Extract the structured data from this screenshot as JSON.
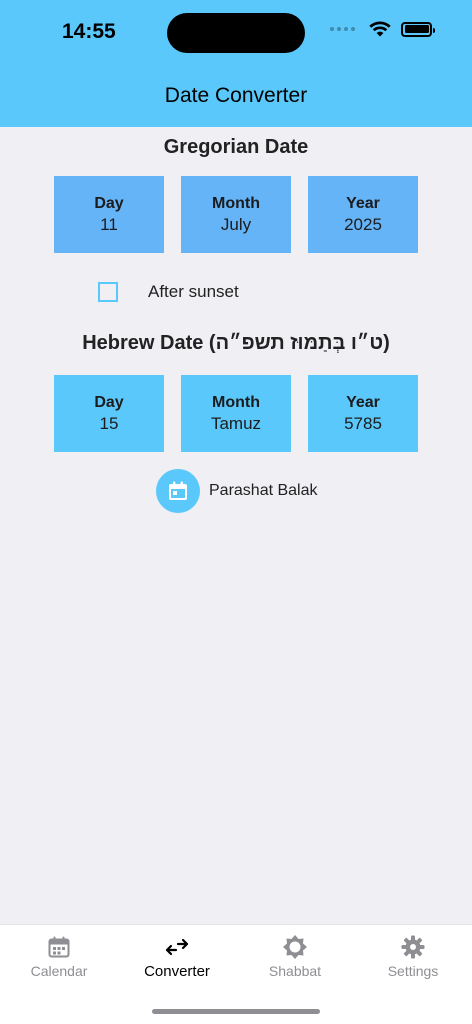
{
  "status_bar": {
    "time": "14:55"
  },
  "nav": {
    "title": "Date Converter"
  },
  "gregorian": {
    "title": "Gregorian Date",
    "day": {
      "label": "Day",
      "value": "11"
    },
    "month": {
      "label": "Month",
      "value": "July"
    },
    "year": {
      "label": "Year",
      "value": "2025"
    }
  },
  "sunset": {
    "label": "After sunset",
    "checked": false
  },
  "hebrew": {
    "title": "Hebrew Date (ט״ו בְּתַמּוּז תשפ״ה)",
    "day": {
      "label": "Day",
      "value": "15"
    },
    "month": {
      "label": "Month",
      "value": "Tamuz"
    },
    "year": {
      "label": "Year",
      "value": "5785"
    }
  },
  "parasha": {
    "label": "Parashat Balak",
    "icon": "calendar-icon"
  },
  "tabs": [
    {
      "label": "Calendar",
      "icon": "calendar-icon",
      "active": false
    },
    {
      "label": "Converter",
      "icon": "swap-arrows-icon",
      "active": true
    },
    {
      "label": "Shabbat",
      "icon": "sun-icon",
      "active": false
    },
    {
      "label": "Settings",
      "icon": "gear-icon",
      "active": false
    }
  ],
  "colors": {
    "header": "#5ac8fa",
    "gregorian_cell": "#64b4f7",
    "hebrew_cell": "#5ac8fa",
    "background": "#efeff4",
    "tab_inactive": "#8e8e93"
  }
}
